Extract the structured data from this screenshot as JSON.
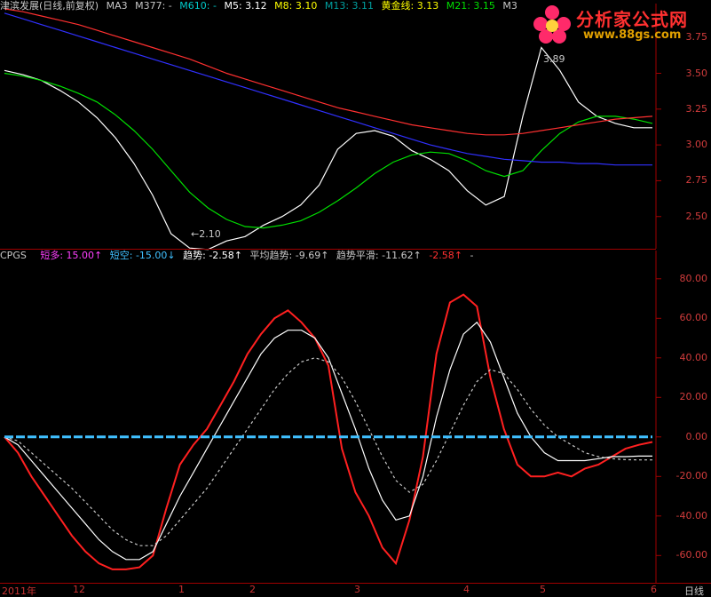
{
  "header": {
    "title": "津滨发展(日线,前复权)",
    "items": [
      {
        "label": "MA3",
        "color": "#c8c8c8"
      },
      {
        "label": "M377: -",
        "color": "#c8c8c8"
      },
      {
        "label": "M610: -",
        "color": "#00c8c8"
      },
      {
        "label": "M5: 3.12",
        "color": "#ffffff"
      },
      {
        "label": "M8: 3.10",
        "color": "#ffff00"
      },
      {
        "label": "M13: 3.11",
        "color": "#00a0a0"
      },
      {
        "label": "黄金线: 3.13",
        "color": "#ffff00"
      },
      {
        "label": "M21: 3.15",
        "color": "#00e000"
      },
      {
        "label": "M3",
        "color": "#c8c8c8"
      }
    ]
  },
  "indicator_header": {
    "name": "CPGS",
    "items": [
      {
        "label": "短多: 15.00↑",
        "color": "#ff40ff"
      },
      {
        "label": "短空: -15.00↓",
        "color": "#40c0ff"
      },
      {
        "label": "趋势: -2.58↑",
        "color": "#ffffff"
      },
      {
        "label": "平均趋势: -9.69↑",
        "color": "#c8c8c8"
      },
      {
        "label": "趋势平滑: -11.62↑",
        "color": "#c8c8c8"
      },
      {
        "label": "-2.58↑",
        "color": "#ff3030"
      },
      {
        "label": "-",
        "color": "#c8c8c8"
      }
    ]
  },
  "watermark": {
    "title": "分析家公式网",
    "url": "www.88gs.com"
  },
  "annotations": {
    "high": "3.89",
    "low": "←2.10"
  },
  "x_axis_labels": [
    "2011年",
    "12",
    "1",
    "2",
    "3",
    "4",
    "5",
    "6"
  ],
  "period_label": "日线",
  "chart_data": [
    {
      "type": "line",
      "title": "津滨发展(日线,前复权)",
      "ylim": [
        2.3,
        3.9
      ],
      "y_ticks": [
        2.5,
        2.75,
        3.0,
        3.25,
        3.5,
        3.75
      ],
      "y_tick_labels": [
        "2.50",
        "2.75",
        "3.00",
        "3.25",
        "3.50",
        "3.75"
      ],
      "price_high": 3.89,
      "price_low": 2.1,
      "series": [
        {
          "name": "MA3",
          "values": [
            3.52,
            3.49,
            3.45,
            3.38,
            3.3,
            3.19,
            3.05,
            2.87,
            2.65,
            2.38,
            2.28,
            2.27,
            2.33,
            2.36,
            2.44,
            2.5,
            2.58,
            2.72,
            2.97,
            3.08,
            3.1,
            3.06,
            2.96,
            2.9,
            2.82,
            2.68,
            2.58,
            2.64,
            3.2,
            3.68,
            3.52,
            3.3,
            3.2,
            3.15,
            3.12,
            3.12
          ],
          "color": "#ffffff"
        },
        {
          "name": "M21",
          "values": [
            3.5,
            3.48,
            3.45,
            3.41,
            3.36,
            3.3,
            3.21,
            3.1,
            2.97,
            2.82,
            2.67,
            2.56,
            2.48,
            2.43,
            2.42,
            2.44,
            2.47,
            2.53,
            2.61,
            2.7,
            2.8,
            2.88,
            2.93,
            2.95,
            2.94,
            2.89,
            2.82,
            2.78,
            2.82,
            2.96,
            3.08,
            3.16,
            3.2,
            3.2,
            3.18,
            3.15
          ],
          "color": "#00e000"
        },
        {
          "name": "M610",
          "values": [
            3.92,
            3.88,
            3.84,
            3.8,
            3.76,
            3.72,
            3.68,
            3.64,
            3.6,
            3.56,
            3.52,
            3.48,
            3.44,
            3.4,
            3.36,
            3.32,
            3.28,
            3.24,
            3.2,
            3.16,
            3.12,
            3.08,
            3.04,
            3.0,
            2.97,
            2.94,
            2.92,
            2.9,
            2.89,
            2.88,
            2.88,
            2.87,
            2.87,
            2.86,
            2.86,
            2.86
          ],
          "color": "#3030ff"
        },
        {
          "name": "M377",
          "values": [
            3.95,
            3.93,
            3.9,
            3.87,
            3.84,
            3.8,
            3.76,
            3.72,
            3.68,
            3.64,
            3.6,
            3.55,
            3.5,
            3.46,
            3.42,
            3.38,
            3.34,
            3.3,
            3.26,
            3.23,
            3.2,
            3.17,
            3.14,
            3.12,
            3.1,
            3.08,
            3.07,
            3.07,
            3.08,
            3.1,
            3.12,
            3.14,
            3.16,
            3.18,
            3.19,
            3.2
          ],
          "color": "#ff3030"
        }
      ]
    },
    {
      "type": "line",
      "title": "CPGS",
      "ylim": [
        -72,
        88
      ],
      "y_ticks": [
        80,
        60,
        40,
        20,
        0,
        -20,
        -40,
        -60
      ],
      "y_tick_labels": [
        "80.00",
        "60.00",
        "40.00",
        "20.00",
        "0.00",
        "-20.00",
        "-40.00",
        "-60.00"
      ],
      "series": [
        {
          "name": "趋势",
          "values": [
            0,
            -8,
            -20,
            -30,
            -40,
            -50,
            -58,
            -64,
            -67,
            -67,
            -66,
            -60,
            -36,
            -14,
            -4,
            4,
            16,
            28,
            42,
            52,
            60,
            64,
            58,
            50,
            36,
            -6,
            -28,
            -40,
            -56,
            -64,
            -42,
            -10,
            42,
            68,
            72,
            66,
            30,
            4,
            -14,
            -20,
            -20,
            -18,
            -20,
            -16,
            -14,
            -10,
            -6,
            -4,
            -2.58
          ],
          "color": "#ff2020"
        },
        {
          "name": "平均趋势",
          "values": [
            0,
            -4,
            -12,
            -20,
            -28,
            -36,
            -44,
            -52,
            -58,
            -62,
            -62,
            -58,
            -44,
            -30,
            -18,
            -6,
            6,
            18,
            30,
            42,
            50,
            54,
            54,
            50,
            40,
            22,
            4,
            -16,
            -32,
            -42,
            -40,
            -20,
            10,
            34,
            52,
            58,
            48,
            30,
            12,
            0,
            -8,
            -12,
            -12,
            -12,
            -11,
            -10,
            -10,
            -9.69,
            -9.69
          ],
          "color": "#ffffff"
        },
        {
          "name": "趋势平滑",
          "values": [
            0,
            -2,
            -8,
            -14,
            -20,
            -26,
            -33,
            -40,
            -47,
            -52,
            -55,
            -55,
            -50,
            -42,
            -34,
            -26,
            -16,
            -6,
            4,
            14,
            24,
            32,
            38,
            40,
            38,
            30,
            18,
            4,
            -10,
            -22,
            -28,
            -24,
            -12,
            2,
            16,
            28,
            34,
            32,
            24,
            14,
            6,
            0,
            -4,
            -8,
            -10,
            -11,
            -11.5,
            -11.62,
            -11.62
          ],
          "color": "#c8c8c8"
        }
      ]
    }
  ]
}
